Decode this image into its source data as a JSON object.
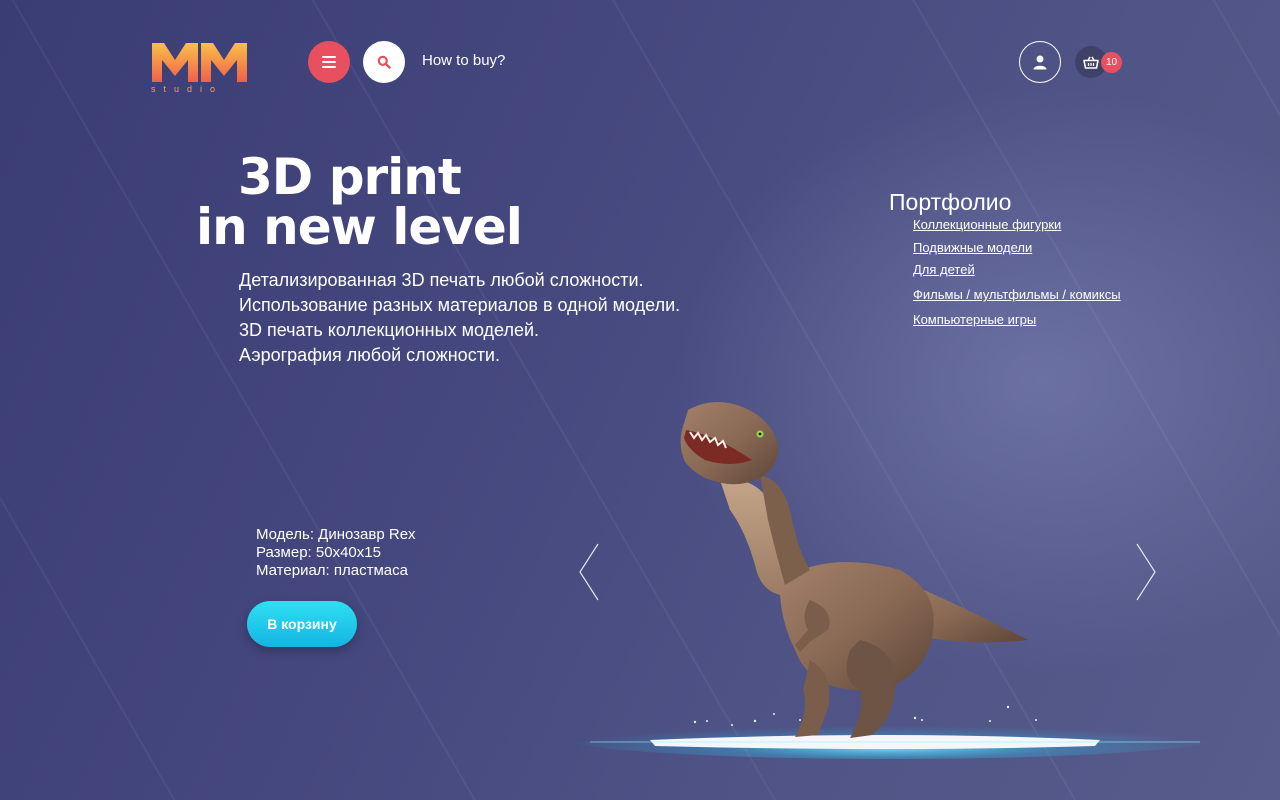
{
  "brand": {
    "logo_letters": "MM",
    "logo_sub": "studio"
  },
  "header": {
    "menu_icon": "hamburger-icon",
    "search_icon": "search-icon",
    "how_to_buy": "How to buy?",
    "user_icon": "user-icon",
    "cart_icon": "basket-icon",
    "cart_count": "10"
  },
  "hero": {
    "title_line1": "3D print",
    "title_line2": "in new level",
    "features": [
      "Детализированная 3D печать любой сложности.",
      "Использование разных материалов в одной модели.",
      "3D печать коллекционных моделей.",
      "Аэрография любой сложности."
    ]
  },
  "portfolio": {
    "title": "Портфолио",
    "links": [
      "Коллекционные фигурки",
      "Подвижные модели",
      "Для детей",
      "Фильмы / мультфильмы / комиксы",
      "Компьютерные игры"
    ]
  },
  "product": {
    "model": "Модель: Динозавр Rex",
    "size": "Размер: 50x40x15",
    "material": "Материал: пластмаса",
    "cta": "В корзину"
  },
  "colors": {
    "accent_red": "#e8505f",
    "cta_cyan": "#1fc6ea",
    "logo_orange": "#f7a44b",
    "background": "#45487e"
  }
}
